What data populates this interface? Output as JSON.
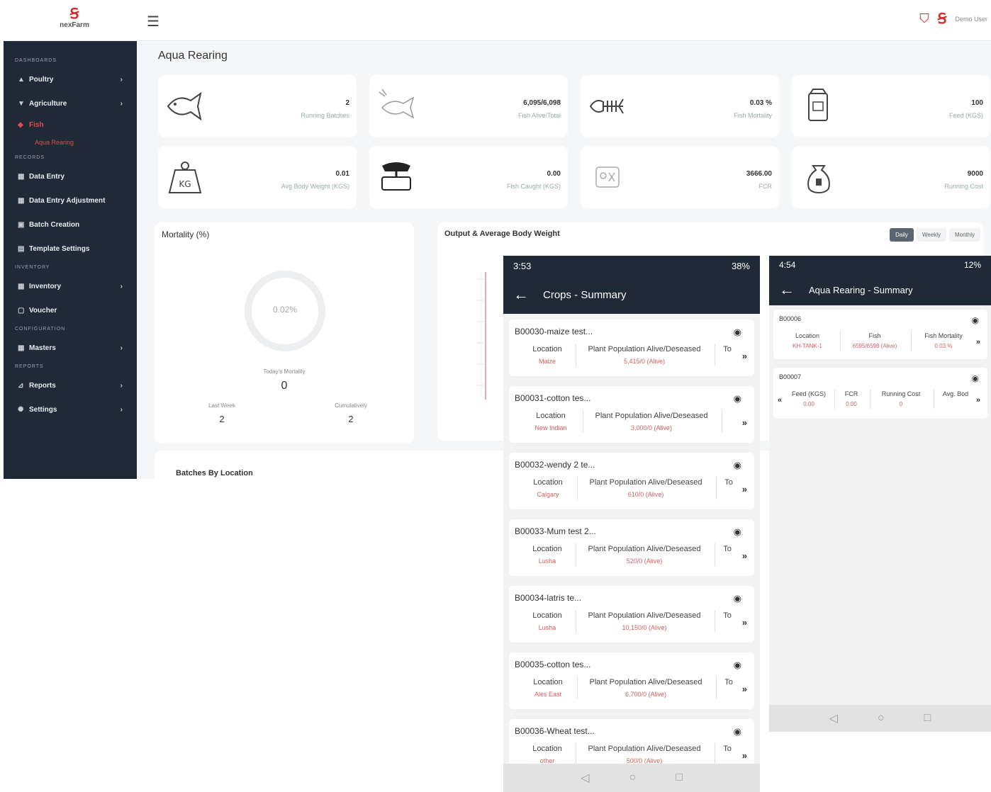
{
  "desktop": {
    "logo_mark": "Ꞩ",
    "logo_name": "nexFarm",
    "menu_icon": "☰",
    "user_name": "Demo User",
    "sidebar": {
      "sections": {
        "s0": "Dashboards",
        "s1": "Records",
        "s2": "Inventory",
        "s3": "Configuration",
        "s4": "Reports"
      },
      "items": [
        {
          "label": "Poultry",
          "icon": "▲"
        },
        {
          "label": "Agriculture",
          "icon": "▼"
        },
        {
          "label": "Fish",
          "icon": "◆"
        },
        {
          "label": "Aqua Rearing",
          "icon": ""
        },
        {
          "label": "Data Entry",
          "icon": "▦"
        },
        {
          "label": "Data Entry Adjustment",
          "icon": "▦"
        },
        {
          "label": "Batch Creation",
          "icon": "▣"
        },
        {
          "label": "Template Settings",
          "icon": "▤"
        },
        {
          "label": "Inventory",
          "icon": "▦"
        },
        {
          "label": "Voucher",
          "icon": "▢"
        },
        {
          "label": "Masters",
          "icon": "▦"
        },
        {
          "label": "Reports",
          "icon": "⊿"
        },
        {
          "label": "Settings",
          "icon": "✺"
        }
      ],
      "chevron": "›"
    },
    "page_title": "Aqua Rearing",
    "cards": [
      {
        "value": "2",
        "label": "Running Batches",
        "icon": "fish-icon"
      },
      {
        "value": "6,095/6,098",
        "label": "Fish Alive/Total",
        "icon": "fish-sketch-icon"
      },
      {
        "value": "0.03 %",
        "label": "Fish Mortality",
        "icon": "fish-bone-icon"
      },
      {
        "value": "100",
        "label": "Feed (KGS)",
        "icon": "feed-bag-icon"
      },
      {
        "value": "0.01",
        "label": "Avg Body Weight (KGS)",
        "icon": "weight-icon"
      },
      {
        "value": "0.00",
        "label": "Fish Caught (KGS)",
        "icon": "scale-icon"
      },
      {
        "value": "3666.00",
        "label": "FCR",
        "icon": "fcr-icon"
      },
      {
        "value": "9000",
        "label": "Running Cost",
        "icon": "money-bag-icon"
      }
    ],
    "mortality": {
      "title": "Mortality (%)",
      "center": "0.02%",
      "today_label": "Today's Mortality",
      "today_value": "0",
      "last_label": "Last Week",
      "last_value": "2",
      "cum_label": "Cumulatively",
      "cum_value": "2"
    },
    "output": {
      "title": "Output & Average Body Weight",
      "toggles": [
        "Daily",
        "Weekly",
        "Monthly"
      ]
    },
    "batches_title": "Batches By Location"
  },
  "crops_phone": {
    "status_time": "3:53",
    "status_right": "38%",
    "title": "Crops - Summary",
    "back": "←",
    "col_location": "Location",
    "col_population": "Plant Population Alive/Deseased",
    "col_to": "To",
    "items": [
      {
        "title": "B00030-maize test...",
        "location": "Maize",
        "population": "5,415/0 (Alive)"
      },
      {
        "title": "B00031-cotton tes...",
        "location": "New Indian",
        "population": "3,000/0 (Alive)"
      },
      {
        "title": "B00032-wendy 2 te...",
        "location": "Calgary",
        "population": "610/0 (Alive)"
      },
      {
        "title": "B00033-Mum test 2...",
        "location": "Lusha",
        "population": "520/0 (Alive)"
      },
      {
        "title": "B00034-latris te...",
        "location": "Lusha",
        "population": "10,150/0 (Alive)"
      },
      {
        "title": "B00035-cotton tes...",
        "location": "Ales East",
        "population": "6,700/0 (Alive)"
      },
      {
        "title": "B00036-Wheat test...",
        "location": "other",
        "population": "500/0 (Alive)"
      }
    ],
    "nav": [
      "◁",
      "○",
      "□"
    ]
  },
  "aqua_phone": {
    "status_time": "4:54",
    "status_right": "12%",
    "title": "Aqua Rearing - Summary",
    "back": "←",
    "b1": {
      "title": "B00006",
      "location_label": "Location",
      "location_value": "KH-TANK-1",
      "fish_label": "Fish",
      "fish_value": "6595/6598 (Alive)",
      "mort_label": "Fish Mortality",
      "mort_value": "0.03 %"
    },
    "b2": {
      "title": "B00007",
      "feed_label": "Feed (KGS)",
      "feed_value": "0.00",
      "fcr_label": "FCR",
      "fcr_value": "0.00",
      "cost_label": "Running Cost",
      "cost_value": "0",
      "avg_label": "Avg. Bod"
    },
    "nav": [
      "◁",
      "○",
      "□"
    ]
  }
}
